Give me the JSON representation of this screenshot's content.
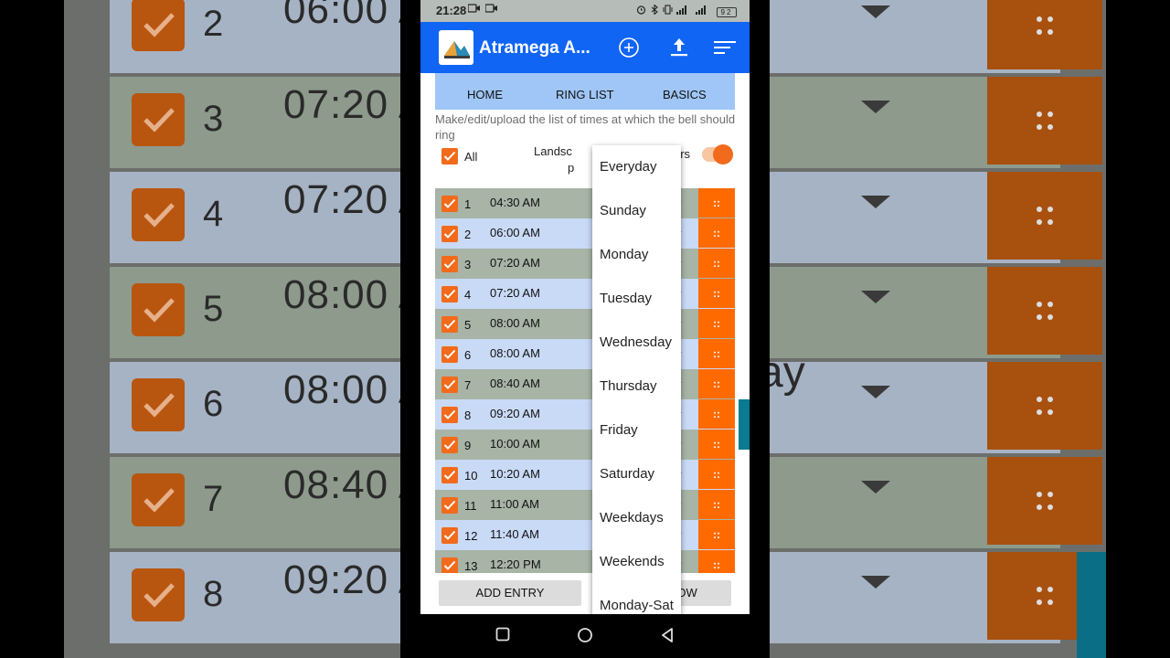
{
  "background": {
    "rows": [
      {
        "num": "2",
        "time": "06:00 A",
        "shade": "blue"
      },
      {
        "num": "3",
        "time": "07:20 A",
        "shade": "green"
      },
      {
        "num": "4",
        "time": "07:20 A",
        "shade": "blue"
      },
      {
        "num": "5",
        "time": "08:00 A",
        "shade": "green"
      },
      {
        "num": "6",
        "time": "08:00 A",
        "shade": "blue"
      },
      {
        "num": "7",
        "time": "08:40 A",
        "shade": "green"
      },
      {
        "num": "8",
        "time": "09:20 A",
        "shade": "blue"
      }
    ],
    "partial_text": "ay"
  },
  "status_bar": {
    "time": "21:28",
    "battery": "92"
  },
  "app_bar": {
    "title": "Atramega A...",
    "icons": [
      "add-circle-icon",
      "upload-icon",
      "sort-icon"
    ]
  },
  "tabs": [
    {
      "label": "HOME"
    },
    {
      "label": "RING LIST"
    },
    {
      "label": "BASICS"
    }
  ],
  "description": "Make/edit/upload the list of times at which the bell should ring",
  "controls": {
    "all_label": "All",
    "all_checked": true,
    "landscape_label": "Landsc",
    "landscape_label_2": "p",
    "hrs_label": "2 Hrs",
    "toggle_on": true
  },
  "entries": [
    {
      "num": "1",
      "time": "04:30 AM",
      "shade": "green"
    },
    {
      "num": "2",
      "time": "06:00 AM",
      "shade": "blue"
    },
    {
      "num": "3",
      "time": "07:20 AM",
      "shade": "green"
    },
    {
      "num": "4",
      "time": "07:20 AM",
      "shade": "blue"
    },
    {
      "num": "5",
      "time": "08:00 AM",
      "shade": "green"
    },
    {
      "num": "6",
      "time": "08:00 AM",
      "shade": "blue"
    },
    {
      "num": "7",
      "time": "08:40 AM",
      "shade": "green"
    },
    {
      "num": "8",
      "time": "09:20 AM",
      "shade": "blue"
    },
    {
      "num": "9",
      "time": "10:00 AM",
      "shade": "green"
    },
    {
      "num": "10",
      "time": "10:20 AM",
      "shade": "blue"
    },
    {
      "num": "11",
      "time": "11:00 AM",
      "shade": "green"
    },
    {
      "num": "12",
      "time": "11:40 AM",
      "shade": "blue"
    },
    {
      "num": "13",
      "time": "12:20 PM",
      "shade": "green"
    }
  ],
  "handle_label": "::",
  "buttons": {
    "add_entry": "ADD ENTRY",
    "now": "D NOW"
  },
  "day_menu": {
    "options": [
      "Everyday",
      "Sunday",
      "Monday",
      "Tuesday",
      "Wednesday",
      "Thursday",
      "Friday",
      "Saturday",
      "Weekdays",
      "Weekends",
      "Monday-Sat"
    ]
  },
  "colors": {
    "app_bar": "#1165f5",
    "tab_bar": "#9fc6f6",
    "accent_orange": "#f26a1b",
    "handle_orange": "#ff6a00",
    "row_green": "#a7b4a6",
    "row_blue": "#c9daf6"
  }
}
